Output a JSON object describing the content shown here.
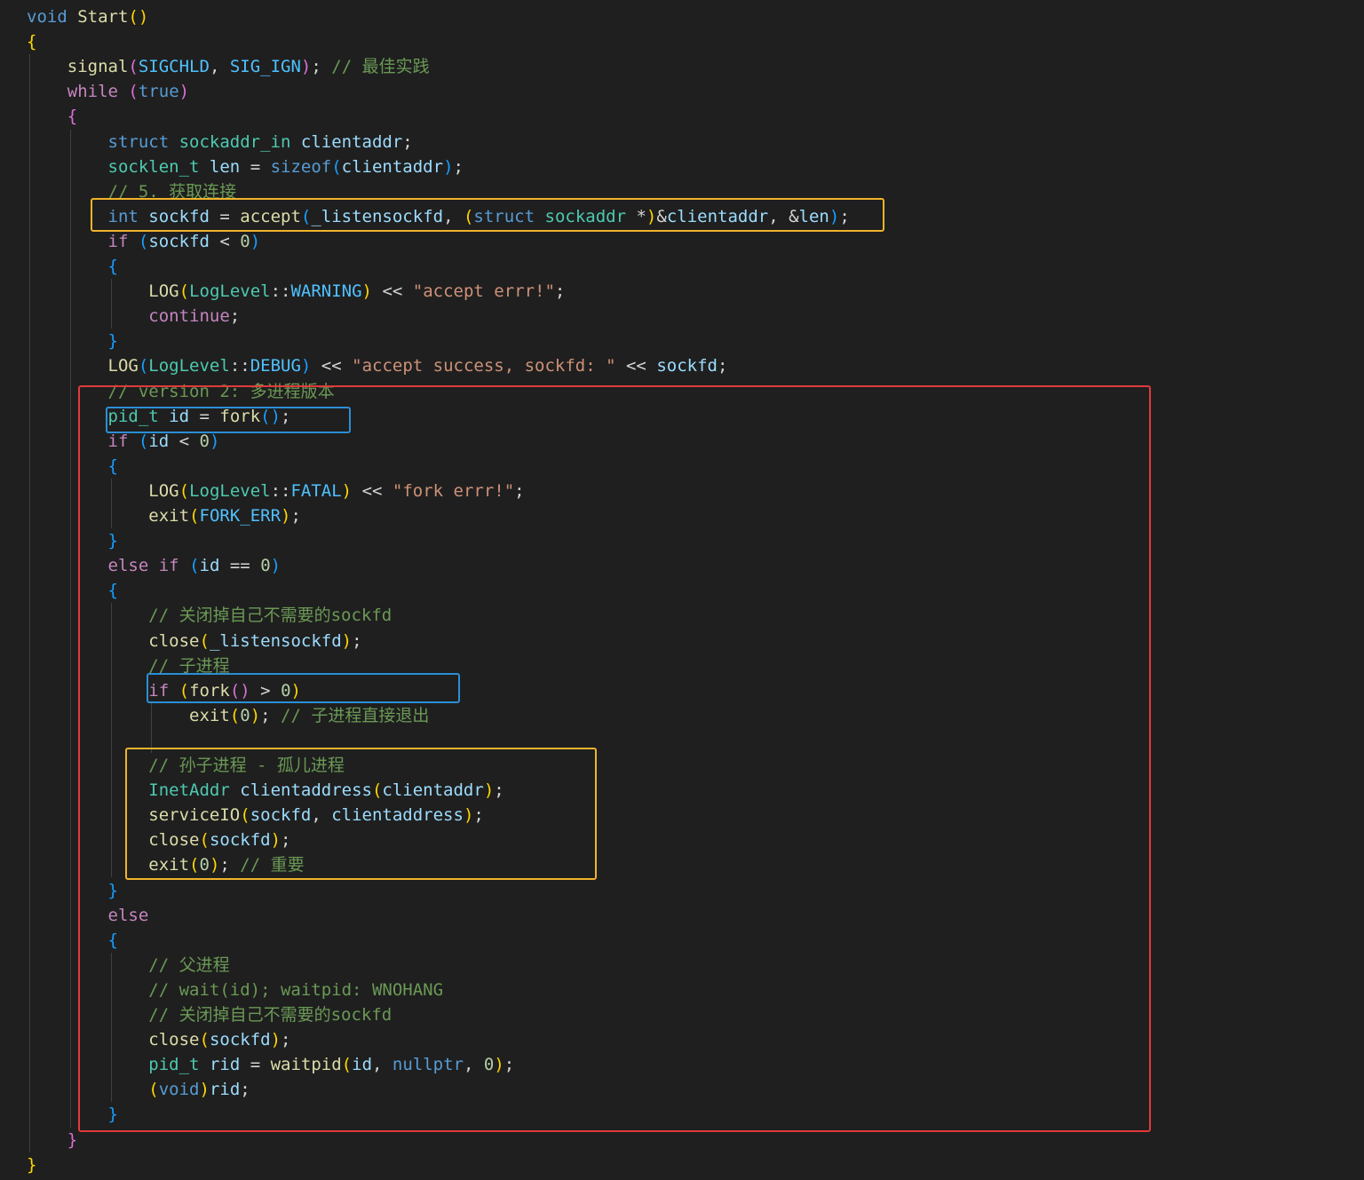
{
  "colors": {
    "background": "#1f1f1f",
    "indent_guide": "#404040",
    "highlight_red": "#e03a3a",
    "highlight_yellow": "#f0b429",
    "highlight_blue": "#2a8fd6"
  },
  "token_colors": {
    "keyword": "#c586c0",
    "control": "#c586c0",
    "storage": "#569cd6",
    "type": "#4ec9b0",
    "function": "#dcdcaa",
    "variable": "#9cdcfe",
    "string": "#ce9178",
    "number": "#b5cea8",
    "comment": "#6a9955",
    "constant": "#4fc1ff",
    "plain": "#d4d4d4",
    "brace1": "#ffd700",
    "brace2": "#da70d6",
    "brace3": "#179fff",
    "op": "#d4d4d4"
  },
  "code_lines": [
    [
      [
        "storage",
        "void"
      ],
      [
        "plain",
        " "
      ],
      [
        "function",
        "Start"
      ],
      [
        "brace1",
        "()"
      ]
    ],
    [
      [
        "brace1",
        "{"
      ]
    ],
    [
      [
        "plain",
        "    "
      ],
      [
        "function",
        "signal"
      ],
      [
        "brace2",
        "("
      ],
      [
        "constant",
        "SIGCHLD"
      ],
      [
        "plain",
        ", "
      ],
      [
        "constant",
        "SIG_IGN"
      ],
      [
        "brace2",
        ")"
      ],
      [
        "plain",
        "; "
      ],
      [
        "comment",
        "// 最佳实践"
      ]
    ],
    [
      [
        "plain",
        "    "
      ],
      [
        "control",
        "while"
      ],
      [
        "plain",
        " "
      ],
      [
        "brace2",
        "("
      ],
      [
        "storage",
        "true"
      ],
      [
        "brace2",
        ")"
      ]
    ],
    [
      [
        "plain",
        "    "
      ],
      [
        "brace2",
        "{"
      ]
    ],
    [
      [
        "plain",
        "        "
      ],
      [
        "storage",
        "struct"
      ],
      [
        "plain",
        " "
      ],
      [
        "type",
        "sockaddr_in"
      ],
      [
        "plain",
        " "
      ],
      [
        "variable",
        "clientaddr"
      ],
      [
        "plain",
        ";"
      ]
    ],
    [
      [
        "plain",
        "        "
      ],
      [
        "type",
        "socklen_t"
      ],
      [
        "plain",
        " "
      ],
      [
        "variable",
        "len"
      ],
      [
        "plain",
        " = "
      ],
      [
        "storage",
        "sizeof"
      ],
      [
        "brace3",
        "("
      ],
      [
        "variable",
        "clientaddr"
      ],
      [
        "brace3",
        ")"
      ],
      [
        "plain",
        ";"
      ]
    ],
    [
      [
        "plain",
        "        "
      ],
      [
        "comment",
        "// 5. 获取连接"
      ]
    ],
    [
      [
        "plain",
        "        "
      ],
      [
        "storage",
        "int"
      ],
      [
        "plain",
        " "
      ],
      [
        "variable",
        "sockfd"
      ],
      [
        "plain",
        " = "
      ],
      [
        "function",
        "accept"
      ],
      [
        "brace3",
        "("
      ],
      [
        "variable",
        "_listensockfd"
      ],
      [
        "plain",
        ", "
      ],
      [
        "brace1",
        "("
      ],
      [
        "storage",
        "struct"
      ],
      [
        "plain",
        " "
      ],
      [
        "type",
        "sockaddr"
      ],
      [
        "plain",
        " *"
      ],
      [
        "brace1",
        ")"
      ],
      [
        "plain",
        "&"
      ],
      [
        "variable",
        "clientaddr"
      ],
      [
        "plain",
        ", &"
      ],
      [
        "variable",
        "len"
      ],
      [
        "brace3",
        ")"
      ],
      [
        "plain",
        ";"
      ]
    ],
    [
      [
        "plain",
        "        "
      ],
      [
        "control",
        "if"
      ],
      [
        "plain",
        " "
      ],
      [
        "brace3",
        "("
      ],
      [
        "variable",
        "sockfd"
      ],
      [
        "plain",
        " < "
      ],
      [
        "number",
        "0"
      ],
      [
        "brace3",
        ")"
      ]
    ],
    [
      [
        "plain",
        "        "
      ],
      [
        "brace3",
        "{"
      ]
    ],
    [
      [
        "plain",
        "            "
      ],
      [
        "function",
        "LOG"
      ],
      [
        "brace1",
        "("
      ],
      [
        "type",
        "LogLevel"
      ],
      [
        "plain",
        "::"
      ],
      [
        "constant",
        "WARNING"
      ],
      [
        "brace1",
        ")"
      ],
      [
        "plain",
        " << "
      ],
      [
        "string",
        "\"accept errr!\""
      ],
      [
        "plain",
        ";"
      ]
    ],
    [
      [
        "plain",
        "            "
      ],
      [
        "control",
        "continue"
      ],
      [
        "plain",
        ";"
      ]
    ],
    [
      [
        "plain",
        "        "
      ],
      [
        "brace3",
        "}"
      ]
    ],
    [
      [
        "plain",
        "        "
      ],
      [
        "function",
        "LOG"
      ],
      [
        "brace3",
        "("
      ],
      [
        "type",
        "LogLevel"
      ],
      [
        "plain",
        "::"
      ],
      [
        "constant",
        "DEBUG"
      ],
      [
        "brace3",
        ")"
      ],
      [
        "plain",
        " << "
      ],
      [
        "string",
        "\"accept success, sockfd: \""
      ],
      [
        "plain",
        " << "
      ],
      [
        "variable",
        "sockfd"
      ],
      [
        "plain",
        ";"
      ]
    ],
    [
      [
        "plain",
        "        "
      ],
      [
        "comment",
        "// version 2: 多进程版本"
      ]
    ],
    [
      [
        "plain",
        "        "
      ],
      [
        "type",
        "pid_t"
      ],
      [
        "plain",
        " "
      ],
      [
        "variable",
        "id"
      ],
      [
        "plain",
        " = "
      ],
      [
        "function",
        "fork"
      ],
      [
        "brace3",
        "()"
      ],
      [
        "plain",
        ";"
      ]
    ],
    [
      [
        "plain",
        "        "
      ],
      [
        "control",
        "if"
      ],
      [
        "plain",
        " "
      ],
      [
        "brace3",
        "("
      ],
      [
        "variable",
        "id"
      ],
      [
        "plain",
        " < "
      ],
      [
        "number",
        "0"
      ],
      [
        "brace3",
        ")"
      ]
    ],
    [
      [
        "plain",
        "        "
      ],
      [
        "brace3",
        "{"
      ]
    ],
    [
      [
        "plain",
        "            "
      ],
      [
        "function",
        "LOG"
      ],
      [
        "brace1",
        "("
      ],
      [
        "type",
        "LogLevel"
      ],
      [
        "plain",
        "::"
      ],
      [
        "constant",
        "FATAL"
      ],
      [
        "brace1",
        ")"
      ],
      [
        "plain",
        " << "
      ],
      [
        "string",
        "\"fork errr!\""
      ],
      [
        "plain",
        ";"
      ]
    ],
    [
      [
        "plain",
        "            "
      ],
      [
        "function",
        "exit"
      ],
      [
        "brace1",
        "("
      ],
      [
        "constant",
        "FORK_ERR"
      ],
      [
        "brace1",
        ")"
      ],
      [
        "plain",
        ";"
      ]
    ],
    [
      [
        "plain",
        "        "
      ],
      [
        "brace3",
        "}"
      ]
    ],
    [
      [
        "plain",
        "        "
      ],
      [
        "control",
        "else"
      ],
      [
        "plain",
        " "
      ],
      [
        "control",
        "if"
      ],
      [
        "plain",
        " "
      ],
      [
        "brace3",
        "("
      ],
      [
        "variable",
        "id"
      ],
      [
        "plain",
        " == "
      ],
      [
        "number",
        "0"
      ],
      [
        "brace3",
        ")"
      ]
    ],
    [
      [
        "plain",
        "        "
      ],
      [
        "brace3",
        "{"
      ]
    ],
    [
      [
        "plain",
        "            "
      ],
      [
        "comment",
        "// 关闭掉自己不需要的sockfd"
      ]
    ],
    [
      [
        "plain",
        "            "
      ],
      [
        "function",
        "close"
      ],
      [
        "brace1",
        "("
      ],
      [
        "variable",
        "_listensockfd"
      ],
      [
        "brace1",
        ")"
      ],
      [
        "plain",
        ";"
      ]
    ],
    [
      [
        "plain",
        "            "
      ],
      [
        "comment",
        "// 子进程"
      ]
    ],
    [
      [
        "plain",
        "            "
      ],
      [
        "control",
        "if"
      ],
      [
        "plain",
        " "
      ],
      [
        "brace1",
        "("
      ],
      [
        "function",
        "fork"
      ],
      [
        "brace2",
        "()"
      ],
      [
        "plain",
        " > "
      ],
      [
        "number",
        "0"
      ],
      [
        "brace1",
        ")"
      ]
    ],
    [
      [
        "plain",
        "                "
      ],
      [
        "function",
        "exit"
      ],
      [
        "brace1",
        "("
      ],
      [
        "number",
        "0"
      ],
      [
        "brace1",
        ")"
      ],
      [
        "plain",
        "; "
      ],
      [
        "comment",
        "// 子进程直接退出"
      ]
    ],
    [],
    [
      [
        "plain",
        "            "
      ],
      [
        "comment",
        "// 孙子进程 - 孤儿进程"
      ]
    ],
    [
      [
        "plain",
        "            "
      ],
      [
        "type",
        "InetAddr"
      ],
      [
        "plain",
        " "
      ],
      [
        "variable",
        "clientaddress"
      ],
      [
        "brace1",
        "("
      ],
      [
        "variable",
        "clientaddr"
      ],
      [
        "brace1",
        ")"
      ],
      [
        "plain",
        ";"
      ]
    ],
    [
      [
        "plain",
        "            "
      ],
      [
        "function",
        "serviceIO"
      ],
      [
        "brace1",
        "("
      ],
      [
        "variable",
        "sockfd"
      ],
      [
        "plain",
        ", "
      ],
      [
        "variable",
        "clientaddress"
      ],
      [
        "brace1",
        ")"
      ],
      [
        "plain",
        ";"
      ]
    ],
    [
      [
        "plain",
        "            "
      ],
      [
        "function",
        "close"
      ],
      [
        "brace1",
        "("
      ],
      [
        "variable",
        "sockfd"
      ],
      [
        "brace1",
        ")"
      ],
      [
        "plain",
        ";"
      ]
    ],
    [
      [
        "plain",
        "            "
      ],
      [
        "function",
        "exit"
      ],
      [
        "brace1",
        "("
      ],
      [
        "number",
        "0"
      ],
      [
        "brace1",
        ")"
      ],
      [
        "plain",
        "; "
      ],
      [
        "comment",
        "// 重要"
      ]
    ],
    [
      [
        "plain",
        "        "
      ],
      [
        "brace3",
        "}"
      ]
    ],
    [
      [
        "plain",
        "        "
      ],
      [
        "control",
        "else"
      ]
    ],
    [
      [
        "plain",
        "        "
      ],
      [
        "brace3",
        "{"
      ]
    ],
    [
      [
        "plain",
        "            "
      ],
      [
        "comment",
        "// 父进程"
      ]
    ],
    [
      [
        "plain",
        "            "
      ],
      [
        "comment",
        "// wait(id); waitpid: WNOHANG"
      ]
    ],
    [
      [
        "plain",
        "            "
      ],
      [
        "comment",
        "// 关闭掉自己不需要的sockfd"
      ]
    ],
    [
      [
        "plain",
        "            "
      ],
      [
        "function",
        "close"
      ],
      [
        "brace1",
        "("
      ],
      [
        "variable",
        "sockfd"
      ],
      [
        "brace1",
        ")"
      ],
      [
        "plain",
        ";"
      ]
    ],
    [
      [
        "plain",
        "            "
      ],
      [
        "type",
        "pid_t"
      ],
      [
        "plain",
        " "
      ],
      [
        "variable",
        "rid"
      ],
      [
        "plain",
        " = "
      ],
      [
        "function",
        "waitpid"
      ],
      [
        "brace1",
        "("
      ],
      [
        "variable",
        "id"
      ],
      [
        "plain",
        ", "
      ],
      [
        "storage",
        "nullptr"
      ],
      [
        "plain",
        ", "
      ],
      [
        "number",
        "0"
      ],
      [
        "brace1",
        ")"
      ],
      [
        "plain",
        ";"
      ]
    ],
    [
      [
        "plain",
        "            "
      ],
      [
        "brace1",
        "("
      ],
      [
        "storage",
        "void"
      ],
      [
        "brace1",
        ")"
      ],
      [
        "variable",
        "rid"
      ],
      [
        "plain",
        ";"
      ]
    ],
    [
      [
        "plain",
        "        "
      ],
      [
        "brace3",
        "}"
      ]
    ],
    [
      [
        "plain",
        "    "
      ],
      [
        "brace2",
        "}"
      ]
    ],
    [
      [
        "brace1",
        "}"
      ]
    ]
  ],
  "highlights": [
    {
      "name": "accept-line-highlight",
      "color": "yellow"
    },
    {
      "name": "multiprocess-block-highlight",
      "color": "red"
    },
    {
      "name": "first-fork-highlight",
      "color": "blue"
    },
    {
      "name": "second-fork-highlight",
      "color": "blue"
    },
    {
      "name": "grandchild-block-highlight",
      "color": "yellow"
    }
  ]
}
